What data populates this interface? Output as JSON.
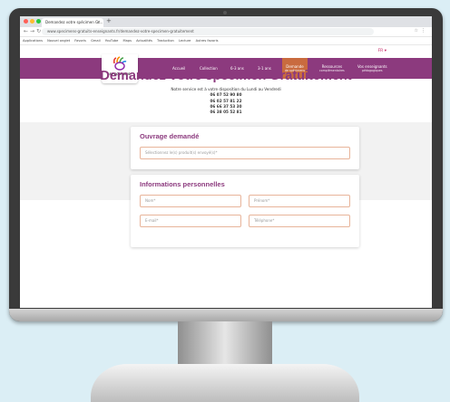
{
  "browser": {
    "tab_title": "Demandez votre spécimen Gr...",
    "new_tab": "+",
    "url": "www.specimens-gratuits-enseignants.fr/demandez-votre-specimen-gratuitement",
    "bookmarks": [
      "Applications",
      "Nouvel onglet",
      "Favoris",
      "Gmail",
      "YouTube",
      "Maps",
      "Actualités",
      "Traduction",
      "Lecture",
      "Autres favoris"
    ]
  },
  "site": {
    "logo_text": "SPECIMENS",
    "lang": "FR ▾",
    "nav": [
      {
        "label": "Accueil"
      },
      {
        "label": "Collection"
      },
      {
        "label": "6-3 ans"
      },
      {
        "label": "3-1 ans"
      }
    ],
    "nav_active": {
      "label": "Demande",
      "sub": "de spécimens"
    },
    "nav_extra": [
      {
        "label": "Ressources",
        "sub": "complémentaires"
      },
      {
        "label": "Vos enseignants",
        "sub": "pédagogiques"
      }
    ]
  },
  "page": {
    "title": "Demandez votre spécimen Gratuitement",
    "info_line": "Notre service est à votre disposition du Lundi au Vendredi",
    "phones": [
      "06 07 52 90 80",
      "06 02 57 81 22",
      "06 66 37 53 30",
      "06 38 05 52 81"
    ]
  },
  "card_ouvrage": {
    "title": "Ouvrage demandé",
    "placeholder": "Sélectionnez le(s) produit(s) envoyé(s)*"
  },
  "card_infos": {
    "title": "Informations personnelles",
    "nom_placeholder": "Nom*",
    "prenom_placeholder": "Prénom*",
    "email_placeholder": "E-mail*",
    "telephone_placeholder": "Téléphone*"
  },
  "colors": {
    "brand": "#8c3a7e",
    "accent": "#c96b3f"
  }
}
